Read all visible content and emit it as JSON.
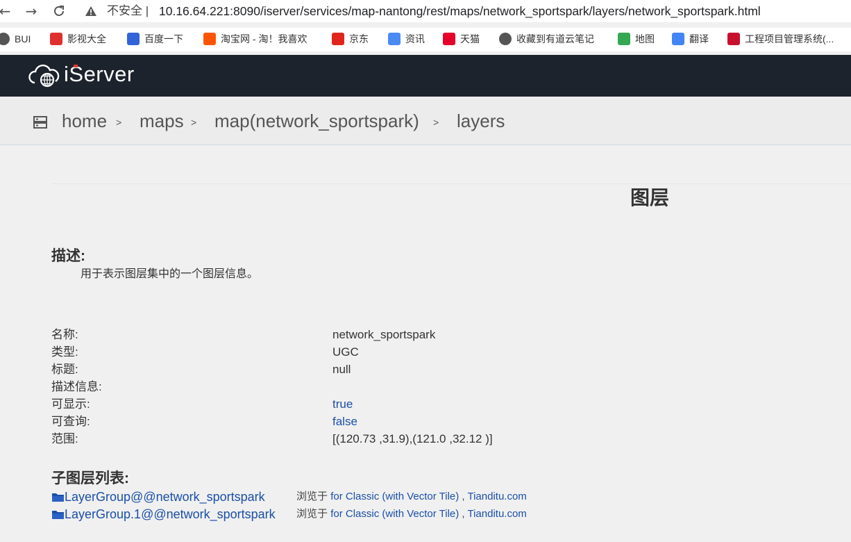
{
  "browser": {
    "insecure_label": "不安全",
    "url": "10.16.64.221:8090/iserver/services/map-nantong/rest/maps/network_sportspark/layers/network_sportspark.html",
    "back_icon": "arrow-left-icon",
    "forward_icon": "arrow-right-icon",
    "reload_icon": "reload-icon",
    "bookmarks": [
      {
        "label": "BUI",
        "icon": "globe-icon",
        "color": "#555555"
      },
      {
        "label": "影视大全",
        "icon": "play-icon",
        "color": "#e0302d"
      },
      {
        "label": "百度一下",
        "icon": "paw-icon",
        "color": "#3264d8"
      },
      {
        "label": "淘宝网 - 淘！我喜欢",
        "icon": "taobao-icon",
        "color": "#ff5500"
      },
      {
        "label": "京东",
        "icon": "jd-icon",
        "color": "#e1251b"
      },
      {
        "label": "资讯",
        "icon": "news-icon",
        "color": "#4a8af4"
      },
      {
        "label": "天猫",
        "icon": "tmall-icon",
        "color": "#e4002b"
      },
      {
        "label": "收藏到有道云笔记",
        "icon": "globe-icon",
        "color": "#555555"
      },
      {
        "label": "地图",
        "icon": "map-pin-icon",
        "color": "#34a853"
      },
      {
        "label": "翻译",
        "icon": "translate-icon",
        "color": "#4285f4"
      },
      {
        "label": "工程项目管理系统(...",
        "icon": "brand-y-icon",
        "color": "#c8102e"
      }
    ]
  },
  "app": {
    "logo_text": "iServer",
    "header_bg": "#1d232d"
  },
  "breadcrumb": {
    "items": [
      "home",
      "maps",
      "map(network_sportspark)",
      "layers"
    ],
    "separator": ">"
  },
  "page": {
    "title": "图层",
    "description_heading": "描述:",
    "description": "用于表示图层集中的一个图层信息。",
    "properties": [
      {
        "label": "名称:",
        "value": "network_sportspark",
        "is_link": false
      },
      {
        "label": "类型:",
        "value": "UGC",
        "is_link": false
      },
      {
        "label": "标题:",
        "value": "null",
        "is_link": false
      },
      {
        "label": "描述信息:",
        "value": "",
        "is_link": false
      },
      {
        "label": "可显示:",
        "value": "true",
        "is_link": true
      },
      {
        "label": "可查询:",
        "value": "false",
        "is_link": true
      },
      {
        "label": "范围:",
        "value": "[(120.73 ,31.9),(121.0 ,32.12 )]",
        "is_link": false
      }
    ],
    "sublayers_heading": "子图层列表:",
    "sublayers": [
      {
        "name": "LayerGroup@@network_sportspark",
        "browse_prefix": "浏览于",
        "classic_link": "for Classic (with Vector Tile)",
        "comma": ",",
        "tianditu_link": "Tianditu.com"
      },
      {
        "name": "LayerGroup.1@@network_sportspark",
        "browse_prefix": "浏览于",
        "classic_link": "for Classic (with Vector Tile)",
        "comma": ",",
        "tianditu_link": "Tianditu.com"
      }
    ],
    "link_color": "#1a4fa8"
  }
}
